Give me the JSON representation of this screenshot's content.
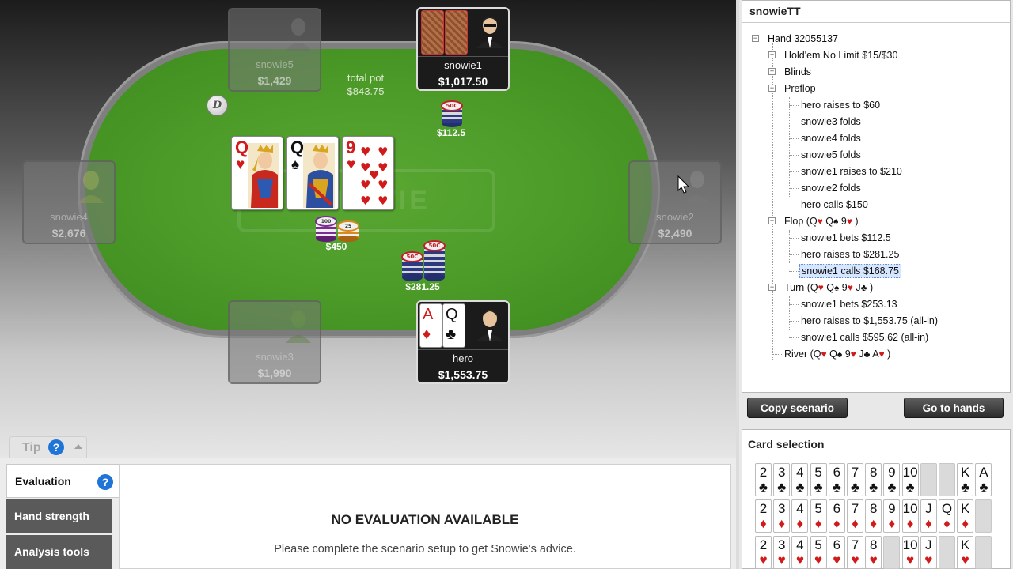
{
  "table": {
    "logo_text": "SNOWIE",
    "pot_label": "total pot",
    "pot_amount": "$843.75",
    "dealer_button": "D",
    "seats": [
      {
        "id": "snowie5",
        "name": "snowie5",
        "stack": "$1,429",
        "state": "empty"
      },
      {
        "id": "snowie1",
        "name": "snowie1",
        "stack": "$1,017.50",
        "state": "active"
      },
      {
        "id": "snowie4",
        "name": "snowie4",
        "stack": "$2,676",
        "state": "empty"
      },
      {
        "id": "snowie2",
        "name": "snowie2",
        "stack": "$2,490",
        "state": "empty"
      },
      {
        "id": "snowie3",
        "name": "snowie3",
        "stack": "$1,990",
        "state": "empty"
      },
      {
        "id": "hero",
        "name": "hero",
        "stack": "$1,553.75",
        "state": "active"
      }
    ],
    "board": [
      {
        "rank": "Q",
        "suit": "♥",
        "color": "#d11a1a"
      },
      {
        "rank": "Q",
        "suit": "♠",
        "color": "#111111"
      },
      {
        "rank": "9",
        "suit": "♥",
        "color": "#d11a1a"
      }
    ],
    "hero_cards": [
      {
        "rank": "A",
        "suit": "♦",
        "color": "#d11a1a"
      },
      {
        "rank": "Q",
        "suit": "♣",
        "color": "#111111"
      }
    ],
    "bets": {
      "snowie1_bet": "$112.5",
      "pot_chips": "$450",
      "hero_bet": "$281.25"
    },
    "chip_labels": {
      "c50": "50C",
      "c100": "100",
      "c25": "25"
    }
  },
  "history": {
    "title": "snowieTT",
    "nodes": {
      "hand": "Hand 32055137",
      "game": "Hold'em No Limit $15/$30",
      "blinds": "Blinds",
      "preflop": "Preflop",
      "pf1": "hero raises to $60",
      "pf2": "snowie3 folds",
      "pf3": "snowie4 folds",
      "pf4": "snowie5 folds",
      "pf5": "snowie1 raises to $210",
      "pf6": "snowie2 folds",
      "pf7": "hero calls $150",
      "flop_label": "Flop (Q",
      "flop_suit1": "♥",
      "flop_mid1": " Q",
      "flop_suit2": "♠",
      "flop_mid2": " 9",
      "flop_suit3": "♥",
      "flop_end": " )",
      "f1": "snowie1 bets $112.5",
      "f2": "hero raises to $281.25",
      "f3": "snowie1 calls $168.75",
      "turn_label": "Turn (Q",
      "turn_suit1": "♥",
      "turn_mid1": " Q",
      "turn_suit2": "♠",
      "turn_mid2": " 9",
      "turn_suit3": "♥",
      "turn_mid3": " J",
      "turn_suit4": "♣",
      "turn_end": " )",
      "t1": "snowie1 bets $253.13",
      "t2": "hero raises to $1,553.75 (all-in)",
      "t3": "snowie1 calls $595.62 (all-in)",
      "river_label": "River (Q",
      "river_suit1": "♥",
      "river_mid1": " Q",
      "river_suit2": "♠",
      "river_mid2": " 9",
      "river_suit3": "♥",
      "river_mid3": " J",
      "river_suit4": "♣",
      "river_mid4": " A",
      "river_suit5": "♥",
      "river_end": " )"
    },
    "copy_button": "Copy scenario",
    "goto_button": "Go to hands"
  },
  "card_selection": {
    "title": "Card selection",
    "rows": [
      {
        "suit": "♣",
        "color": "#111111",
        "cards": [
          "2",
          "3",
          "4",
          "5",
          "6",
          "7",
          "8",
          "9",
          "10",
          "",
          "",
          "K",
          "A"
        ]
      },
      {
        "suit": "♦",
        "color": "#d11a1a",
        "cards": [
          "2",
          "3",
          "4",
          "5",
          "6",
          "7",
          "8",
          "9",
          "10",
          "J",
          "Q",
          "K",
          ""
        ]
      },
      {
        "suit": "♥",
        "color": "#d11a1a",
        "cards": [
          "2",
          "3",
          "4",
          "5",
          "6",
          "7",
          "8",
          "",
          "10",
          "J",
          "",
          "K",
          ""
        ]
      }
    ]
  },
  "analysis": {
    "tip_label": "Tip",
    "help_glyph": "?",
    "tabs": [
      "Evaluation",
      "Hand strength",
      "Analysis tools"
    ],
    "eval_title": "NO EVALUATION AVAILABLE",
    "eval_text": "Please complete the scenario setup to get Snowie's advice."
  }
}
